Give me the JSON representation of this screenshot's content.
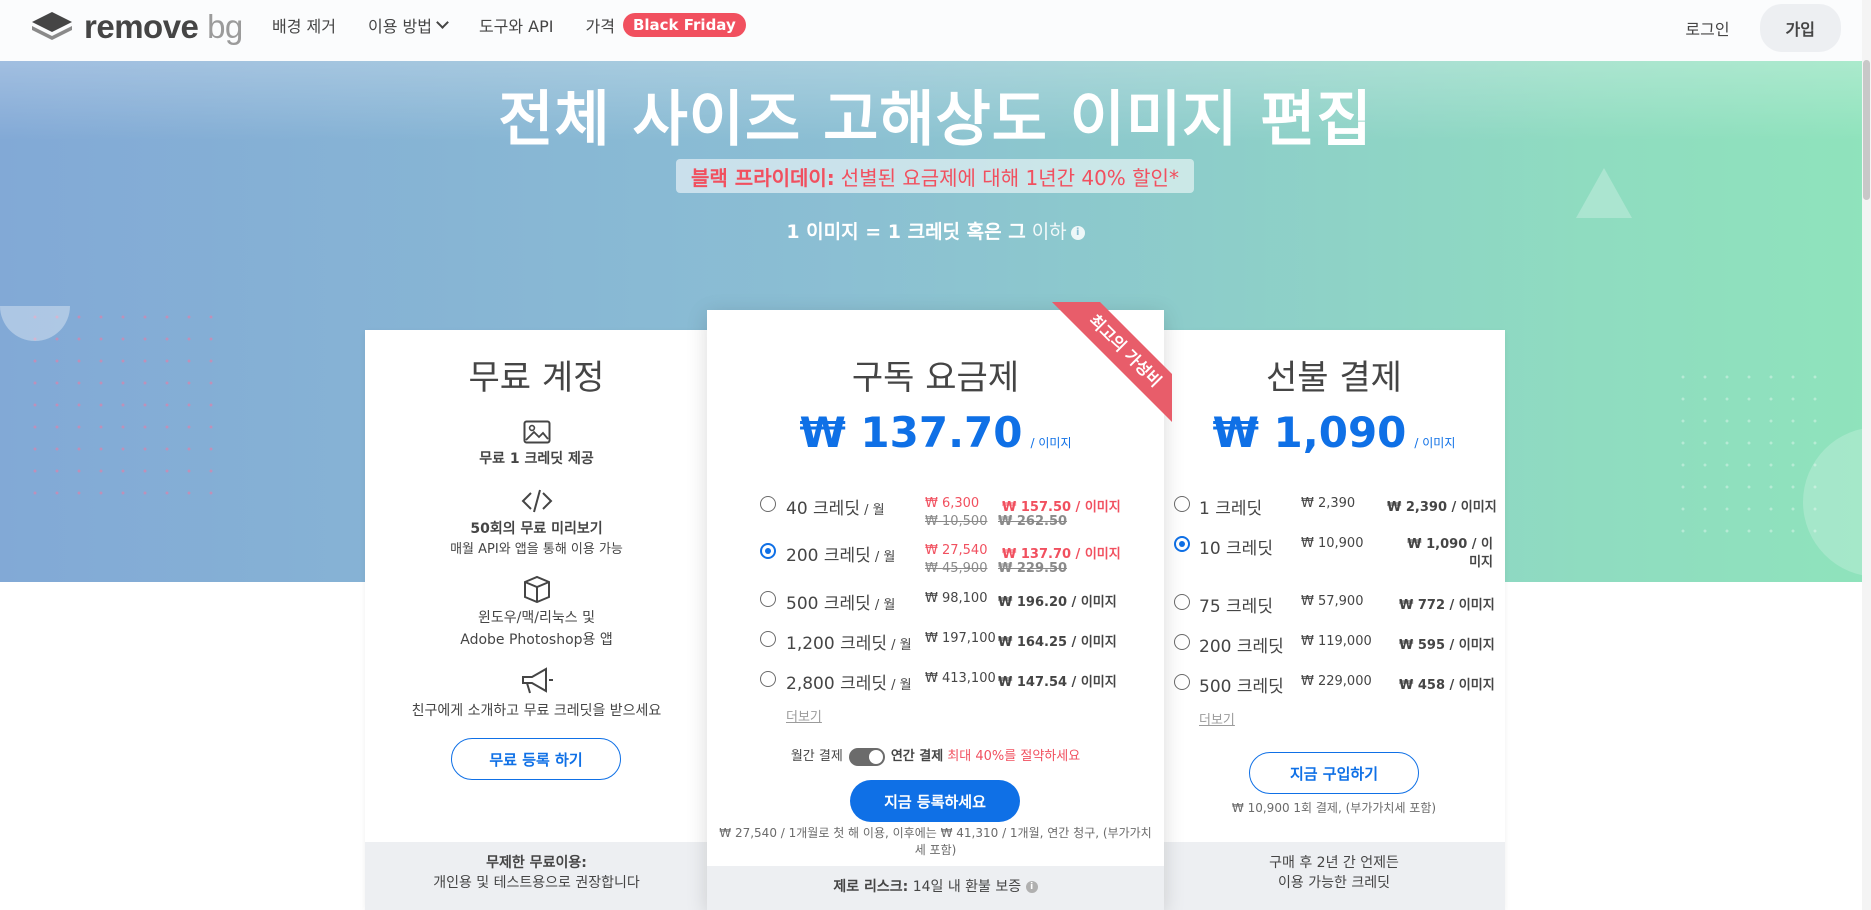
{
  "nav": {
    "logo_main": "remove",
    "logo_bg": "bg",
    "links": {
      "remove_bg": "배경 제거",
      "how_to": "이용 방법",
      "tools_api": "도구와 API",
      "pricing": "가격"
    },
    "badge": "Black Friday",
    "login": "로그인",
    "signup": "가입"
  },
  "hero": {
    "title": "전체 사이즈 고해상도 이미지 편집",
    "promo_bold": "블랙 프라이데이:",
    "promo_text": "선별된 요금제에 대해 1년간 40% 할인*",
    "credit_bold": "1 이미지 = 1 크레딧 혹은 그",
    "credit_lite": "이하",
    "info_symbol": "i"
  },
  "free": {
    "title": "무료 계정",
    "feat1": "무료 1 크레딧 제공",
    "feat2_bold": "50회의 무료 미리보기",
    "feat2_sub": "매월 API와 앱을 통해 이용 가능",
    "feat3_line1": "윈도우/맥/리눅스 및",
    "feat3_line2": "Adobe Photoshop용 앱",
    "feat4": "친구에게 소개하고 무료 크레딧을 받으세요",
    "button": "무료 등록 하기",
    "foot_bold": "무제한 무료이용:",
    "foot_sub": "개인용 및 테스트용으로 권장합니다"
  },
  "subscription": {
    "title": "구독 요금제",
    "ribbon": "최고의 가성비",
    "price": "₩ 137.70",
    "unit": "/ 이미지",
    "options": [
      {
        "label": "40 크레딧",
        "period": " / 월",
        "price": "₩ 6,300",
        "per": "₩ 157.50 / 이미지",
        "old_price": "₩ 10,500",
        "old_per": "₩ 262.50",
        "selected": false,
        "discount": true
      },
      {
        "label": "200 크레딧",
        "period": " / 월",
        "price": "₩ 27,540",
        "per": "₩ 137.70 / 이미지",
        "old_price": "₩ 45,900",
        "old_per": "₩ 229.50",
        "selected": true,
        "discount": true
      },
      {
        "label": "500 크레딧",
        "period": " / 월",
        "price": "₩ 98,100",
        "per": "₩ 196.20 / 이미지",
        "selected": false,
        "discount": false
      },
      {
        "label": "1,200 크레딧",
        "period": " / 월",
        "price": "₩ 197,100",
        "per": "₩ 164.25 / 이미지",
        "selected": false,
        "discount": false
      },
      {
        "label": "2,800 크레딧",
        "period": " / 월",
        "price": "₩ 413,100",
        "per": "₩ 147.54 / 이미지",
        "selected": false,
        "discount": false
      }
    ],
    "more": "더보기",
    "toggle_monthly": "월간 결제",
    "toggle_annual": "연간 결제",
    "toggle_save": "최대 40%를 절약하세요",
    "button": "지금 등록하세요",
    "fine_print": "₩ 27,540 / 1개월로 첫 해 이용, 이후에는 ₩ 41,310 / 1개월, 연간 청구, (부가가치세 포함)",
    "foot_bold": "제로 리스크:",
    "foot_text": "14일 내 환불 보증"
  },
  "prepaid": {
    "title": "선불 결제",
    "price": "₩ 1,090",
    "unit": "/ 이미지",
    "options": [
      {
        "label": "1 크레딧",
        "price": "₩ 2,390",
        "per": "₩ 2,390 / 이미지",
        "selected": false
      },
      {
        "label": "10 크레딧",
        "price": "₩ 10,900",
        "per": "₩ 1,090 / 이미지",
        "selected": true
      },
      {
        "label": "75 크레딧",
        "price": "₩ 57,900",
        "per": "₩ 772 / 이미지",
        "selected": false
      },
      {
        "label": "200 크레딧",
        "price": "₩ 119,000",
        "per": "₩ 595 / 이미지",
        "selected": false
      },
      {
        "label": "500 크레딧",
        "price": "₩ 229,000",
        "per": "₩ 458 / 이미지",
        "selected": false
      }
    ],
    "more": "더보기",
    "button": "지금 구입하기",
    "fine_print": "₩ 10,900 1회 결제, (부가가치세 포함)",
    "foot_line1": "구매 후 2년 간 언제든",
    "foot_line2": "이용 가능한 크레딧"
  },
  "colors": {
    "accent": "#0f70e6",
    "promo_red": "#f1505f",
    "ribbon": "#e85d6a"
  }
}
